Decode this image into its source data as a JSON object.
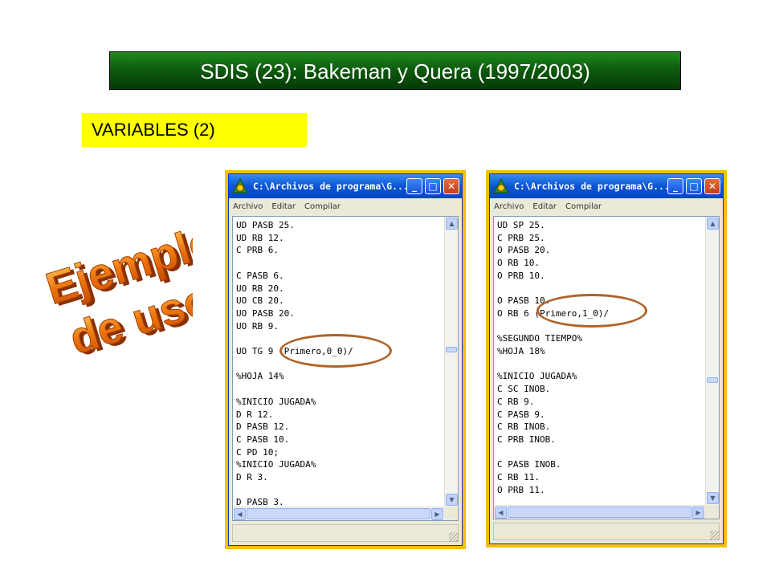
{
  "slide": {
    "title": "SDIS (23): Bakeman y Quera (1997/2003)",
    "section_label": "VARIABLES (2)",
    "stamp_line1": "Ejemplo",
    "stamp_line2": "de uso"
  },
  "windows": [
    {
      "title": "C:\\Archivos de programa\\G...",
      "menu": [
        "Archivo",
        "Editar",
        "Compilar"
      ],
      "code": "UD PASB 25.\nUD RB 12.\nC PRB 6.\n\nC PASB 6.\nUO RB 20.\nUO CB 20.\nUO PASB 20.\nUO RB 9.\n\nUO TG 9 (Primero,0_0)/\n\n%HOJA 14%\n\n%INICIO JUGADA%\nD R 12.\nD PASB 12.\nC PASB 10.\nC PD 10;\n%INICIO JUGADA%\nD R 3.\n\nD PASB 3."
    },
    {
      "title": "C:\\Archivos de programa\\G...",
      "menu": [
        "Archivo",
        "Editar",
        "Compilar"
      ],
      "code": "UD SP 25.\nC PRB 25.\nO PASB 20.\nO RB 10.\nO PRB 10.\n\nO PASB 10.\nO RB 6 (Primero,1_0)/\n\n%SEGUNDO TIEMPO%\n%HOJA 18%\n\n%INICIO JUGADA%\nC SC INOB.\nC RB 9.\nC PASB 9.\nC RB INOB.\nC PRB INOB.\n\nC PASB INOB.\nC RB 11.\nO PRB 11."
    }
  ],
  "colors": {
    "title_bg": "#0e5c0e",
    "label_bg": "#ffff00",
    "window_border": "#f5c000",
    "highlight_oval": "#b0642b",
    "stamp": "#f07810"
  }
}
